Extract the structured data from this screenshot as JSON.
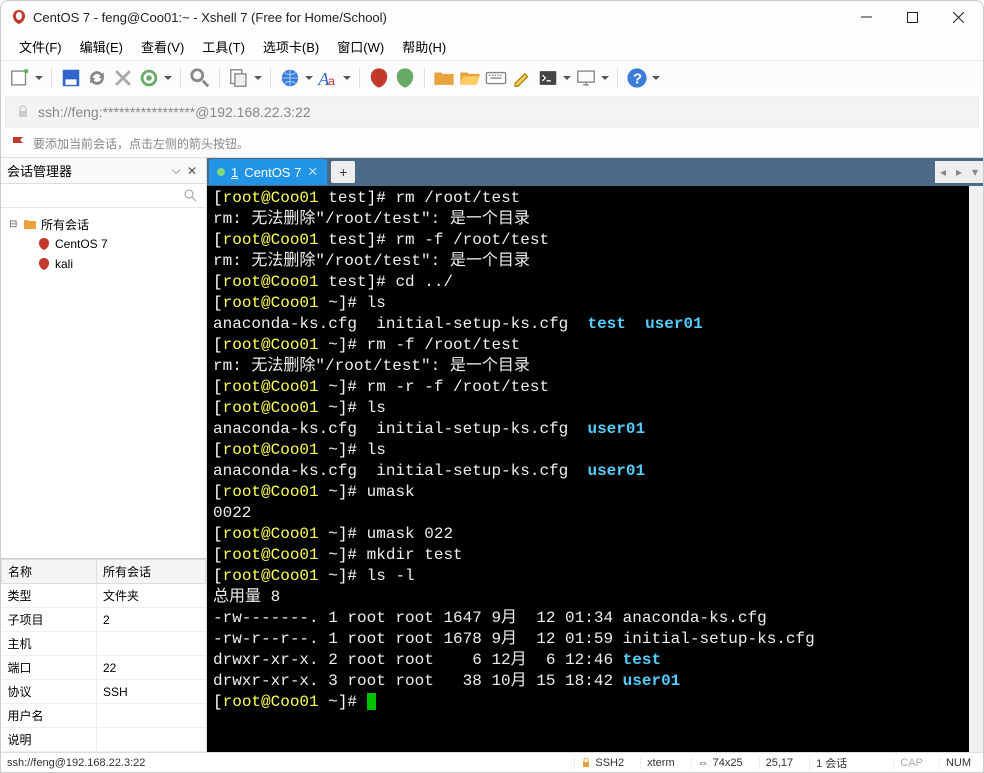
{
  "window": {
    "title": "CentOS 7 - feng@Coo01:~ - Xshell 7 (Free for Home/School)"
  },
  "menu": {
    "file": "文件(F)",
    "edit": "编辑(E)",
    "view": "查看(V)",
    "tools": "工具(T)",
    "tabs": "选项卡(B)",
    "window": "窗口(W)",
    "help": "帮助(H)"
  },
  "address": {
    "text": "ssh://feng:*****************@192.168.22.3:22"
  },
  "hint": {
    "text": "要添加当前会话，点击左侧的箭头按钮。"
  },
  "session_panel": {
    "title": "会话管理器",
    "root": "所有会话",
    "items": [
      "CentOS 7",
      "kali"
    ]
  },
  "props": {
    "header_name": "名称",
    "header_sess": "所有会话",
    "rows": [
      {
        "k": "类型",
        "v": "文件夹"
      },
      {
        "k": "子项目",
        "v": "2"
      },
      {
        "k": "主机",
        "v": ""
      },
      {
        "k": "端口",
        "v": "22"
      },
      {
        "k": "协议",
        "v": "SSH"
      },
      {
        "k": "用户名",
        "v": ""
      },
      {
        "k": "说明",
        "v": ""
      }
    ]
  },
  "tab": {
    "num": "1",
    "label": "CentOS 7"
  },
  "terminal": {
    "lines": [
      {
        "type": "prompt",
        "user": "root@Coo01",
        "path": "test",
        "cmd": "rm /root/test"
      },
      {
        "type": "text",
        "text": "rm: 无法删除\"/root/test\": 是一个目录"
      },
      {
        "type": "prompt",
        "user": "root@Coo01",
        "path": "test",
        "cmd": "rm -f /root/test"
      },
      {
        "type": "text",
        "text": "rm: 无法删除\"/root/test\": 是一个目录"
      },
      {
        "type": "prompt",
        "user": "root@Coo01",
        "path": "test",
        "cmd": "cd ../"
      },
      {
        "type": "prompt",
        "user": "root@Coo01",
        "path": "~",
        "cmd": "ls"
      },
      {
        "type": "ls1",
        "a": "anaconda-ks.cfg  initial-setup-ks.cfg  ",
        "t": "test",
        "u": "  user01"
      },
      {
        "type": "prompt",
        "user": "root@Coo01",
        "path": "~",
        "cmd": "rm -f /root/test"
      },
      {
        "type": "text",
        "text": "rm: 无法删除\"/root/test\": 是一个目录"
      },
      {
        "type": "prompt",
        "user": "root@Coo01",
        "path": "~",
        "cmd": "rm -r -f /root/test"
      },
      {
        "type": "prompt",
        "user": "root@Coo01",
        "path": "~",
        "cmd": "ls"
      },
      {
        "type": "ls2",
        "a": "anaconda-ks.cfg  initial-setup-ks.cfg  ",
        "u": "user01"
      },
      {
        "type": "prompt",
        "user": "root@Coo01",
        "path": "~",
        "cmd": "ls"
      },
      {
        "type": "ls2",
        "a": "anaconda-ks.cfg  initial-setup-ks.cfg  ",
        "u": "user01"
      },
      {
        "type": "prompt",
        "user": "root@Coo01",
        "path": "~",
        "cmd": "umask"
      },
      {
        "type": "text",
        "text": "0022"
      },
      {
        "type": "prompt",
        "user": "root@Coo01",
        "path": "~",
        "cmd": "umask 022"
      },
      {
        "type": "prompt",
        "user": "root@Coo01",
        "path": "~",
        "cmd": "mkdir test"
      },
      {
        "type": "prompt",
        "user": "root@Coo01",
        "path": "~",
        "cmd": "ls -l"
      },
      {
        "type": "text",
        "text": "总用量 8"
      },
      {
        "type": "ll",
        "perm": "-rw-------. 1 root root 1647 9月  12 01:34 ",
        "name": "anaconda-ks.cfg",
        "cls": ""
      },
      {
        "type": "ll",
        "perm": "-rw-r--r--. 1 root root 1678 9月  12 01:59 ",
        "name": "initial-setup-ks.cfg",
        "cls": ""
      },
      {
        "type": "ll",
        "perm": "drwxr-xr-x. 2 root root    6 12月  6 12:46 ",
        "name": "test",
        "cls": "cyan"
      },
      {
        "type": "ll",
        "perm": "drwxr-xr-x. 3 root root   38 10月 15 18:42 ",
        "name": "user01",
        "cls": "cyan"
      },
      {
        "type": "prompt",
        "user": "root@Coo01",
        "path": "~",
        "cmd": "",
        "cursor": true
      }
    ]
  },
  "status": {
    "left": "ssh://feng@192.168.22.3:22",
    "ssh": "SSH2",
    "term": "xterm",
    "size": "74x25",
    "pos": "25,17",
    "sess": "1 会话",
    "cap": "CAP",
    "num": "NUM"
  }
}
